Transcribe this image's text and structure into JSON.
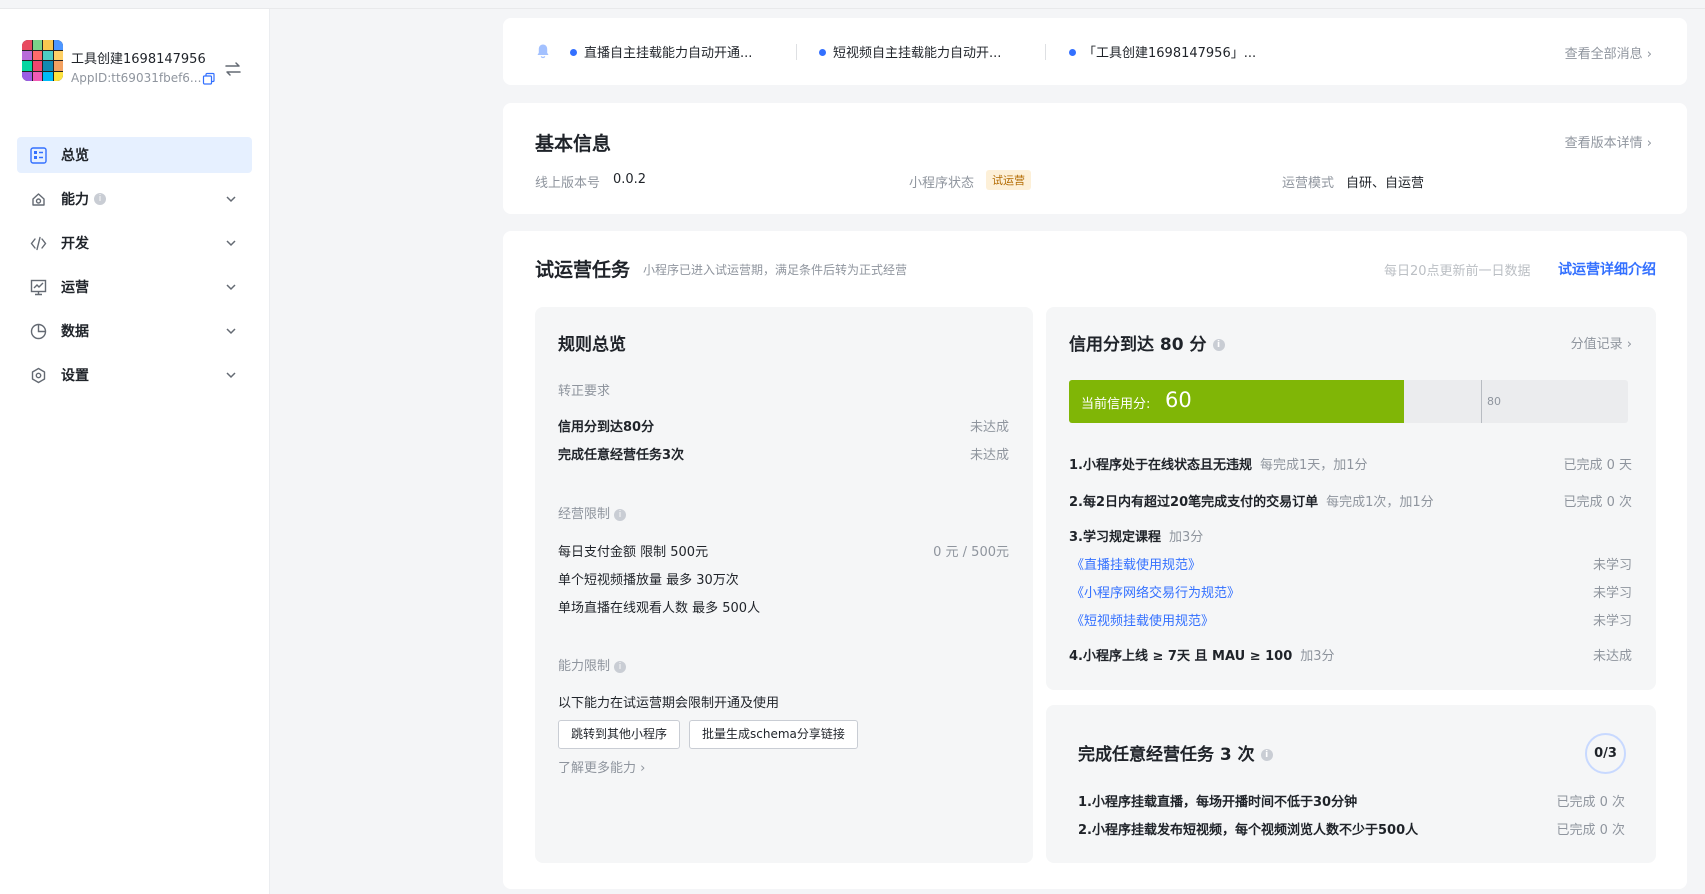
{
  "app": {
    "name": "工具创建1698147956",
    "app_id": "AppID:tt69031fbef6..."
  },
  "sidebar": {
    "items": [
      {
        "label": "总览",
        "icon": "overview-icon"
      },
      {
        "label": "能力",
        "icon": "capability-icon"
      },
      {
        "label": "开发",
        "icon": "code-icon"
      },
      {
        "label": "运营",
        "icon": "operation-icon"
      },
      {
        "label": "数据",
        "icon": "pie-chart-icon"
      },
      {
        "label": "设置",
        "icon": "settings-icon"
      }
    ]
  },
  "notices": {
    "messages": [
      "直播自主挂载能力自动开通...",
      "短视频自主挂载能力自动开...",
      "「工具创建1698147956」..."
    ],
    "view_all": "查看全部消息 ›"
  },
  "basic_info": {
    "title": "基本信息",
    "view_version": "查看版本详情 ›",
    "version_label": "线上版本号",
    "version_value": "0.0.2",
    "status_label": "小程序状态",
    "status_value": "试运营",
    "mode_label": "运营模式",
    "mode_value": "自研、自运营"
  },
  "trial": {
    "title": "试运营任务",
    "subtitle": "小程序已进入试运营期，满足条件后转为正式经营",
    "update_note": "每日20点更新前一日数据",
    "detail_link": "试运营详细介绍",
    "rules": {
      "title": "规则总览",
      "req_label": "转正要求",
      "requirements": [
        {
          "label": "信用分到达80分",
          "status": "未达成"
        },
        {
          "label": "完成任意经营任务3次",
          "status": "未达成"
        }
      ],
      "limits_label": "经营限制",
      "limits": [
        {
          "label": "每日支付金额 限制 500元",
          "value": "0 元  / 500元"
        },
        {
          "label": "单个短视频播放量 最多 30万次",
          "value": ""
        },
        {
          "label": "单场直播在线观看人数 最多 500人",
          "value": ""
        }
      ],
      "cap_label": "能力限制",
      "cap_desc": "以下能力在试运营期会限制开通及使用",
      "cap_buttons": [
        "跳转到其他小程序",
        "批量生成schema分享链接"
      ],
      "learn_more": "了解更多能力 ›"
    },
    "credit": {
      "title": "信用分到达 80 分",
      "history_link": "分值记录 ›",
      "bar_label": "当前信用分:",
      "current": 60,
      "target": 80,
      "progress_fraction": 0.6,
      "accent": "#80b606",
      "tasks": [
        {
          "label": "1.小程序处于在线状态且无违规",
          "note": "每完成1天，加1分",
          "status": "已完成 0 天"
        },
        {
          "label": "2.每2日内有超过20笔完成支付的交易订单",
          "note": "每完成1次，加1分",
          "status": "已完成 0 次"
        },
        {
          "label": "3.学习规定课程",
          "note": "加3分",
          "status": ""
        }
      ],
      "courses": [
        {
          "label": "《直播挂载使用规范》",
          "status": "未学习"
        },
        {
          "label": "《小程序网络交易行为规范》",
          "status": "未学习"
        },
        {
          "label": "《短视频挂载使用规范》",
          "status": "未学习"
        }
      ],
      "task4": {
        "label": "4.小程序上线 ≥ 7天 且 MAU ≥ 100",
        "note": "加3分",
        "status": "未达成"
      }
    },
    "ops": {
      "title": "完成任意经营任务 3 次",
      "progress": "0/3",
      "tasks": [
        {
          "label": "1.小程序挂载直播，每场开播时间不低于30分钟",
          "status": "已完成 0 次"
        },
        {
          "label": "2.小程序挂载发布短视频，每个视频浏览人数不少于500人",
          "status": "已完成 0 次"
        }
      ]
    }
  }
}
